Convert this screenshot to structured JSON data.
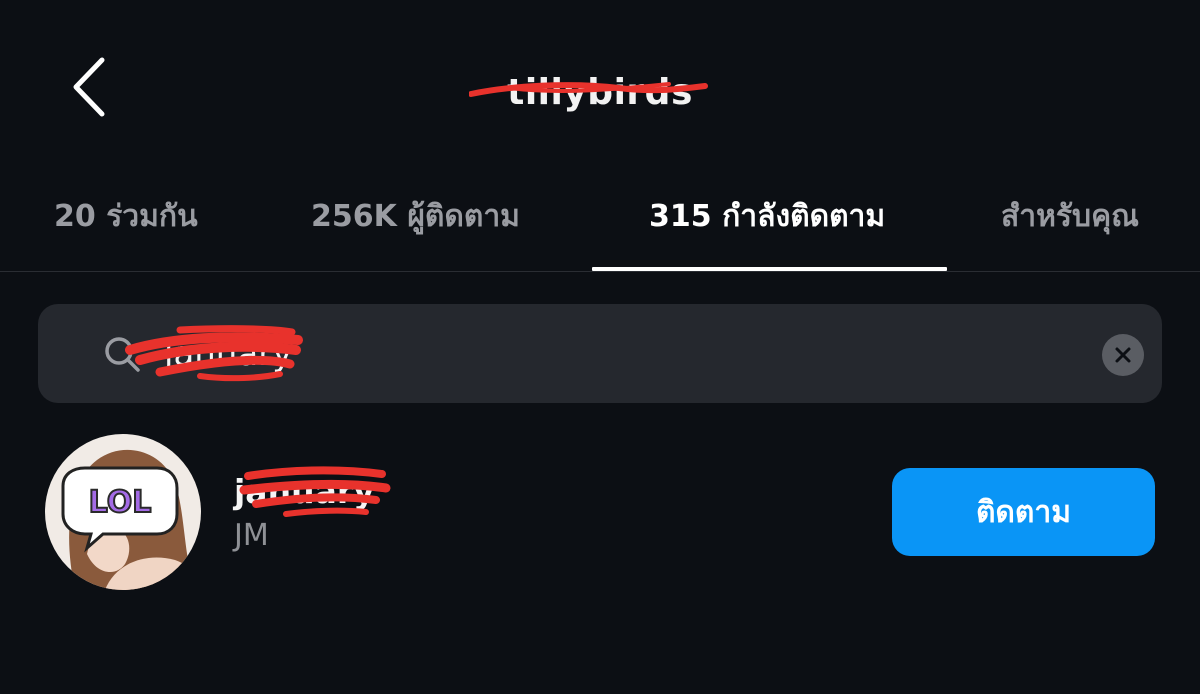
{
  "header": {
    "back_icon": "chevron-left-icon",
    "title": "tillybirds"
  },
  "tabs": [
    {
      "label": "20 ร่วมกัน",
      "active": false
    },
    {
      "label": "256K ผู้ติดตาม",
      "active": false
    },
    {
      "label": "315 กำลังติดตาม",
      "active": true
    },
    {
      "label": "สำหรับคุณ",
      "active": false
    }
  ],
  "search": {
    "icon": "search-icon",
    "value": "january",
    "clear_icon": "clear-icon"
  },
  "results": [
    {
      "username": "january",
      "display_name": "JM",
      "avatar_badge": "LOL",
      "follow_label": "ติดตาม"
    }
  ],
  "colors": {
    "background": "#0c0f14",
    "search_bg": "#25282e",
    "follow_button": "#0a95f6",
    "redaction": "#e8322c",
    "tab_inactive": "#9a9ca2",
    "tab_active": "#ffffff"
  }
}
